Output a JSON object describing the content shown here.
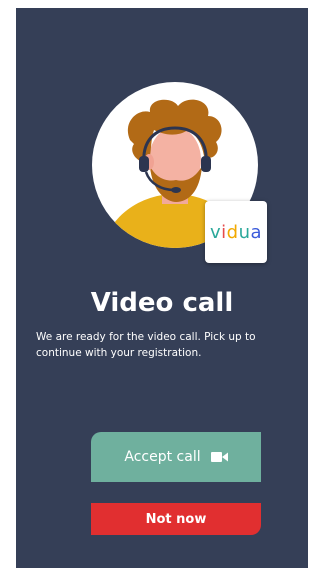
{
  "call": {
    "title": "Video call",
    "message": "We are ready for the video call. Pick up to continue with your registration."
  },
  "brand": {
    "logo_letters": [
      "v",
      "i",
      "d",
      "u",
      "a"
    ],
    "logo_colors": [
      "#2aa89a",
      "#e64b4b",
      "#f2a900",
      "#2aa89a",
      "#3b5bdb"
    ]
  },
  "actions": {
    "accept_label": "Accept call",
    "accept_icon": "video-camera-icon",
    "decline_label": "Not now"
  },
  "colors": {
    "background": "#353f57",
    "accept": "#6fb09e",
    "decline": "#e12f30",
    "text": "#ffffff"
  },
  "avatar": {
    "description_icon": "support-agent-headset-avatar"
  }
}
